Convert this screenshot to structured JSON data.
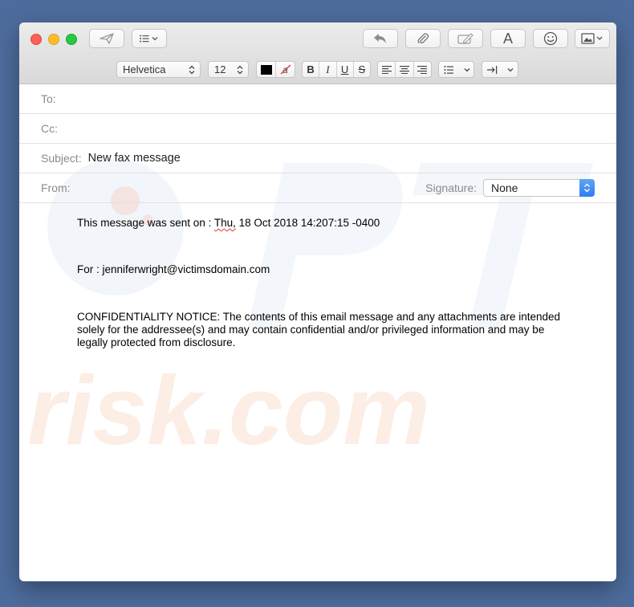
{
  "compose": {
    "toolbar": {
      "font_name": "Helvetica",
      "font_size": "12",
      "bold": "B",
      "italic": "I",
      "underline": "U",
      "strike": "S",
      "font_icon_label": "A"
    },
    "to_label": "To:",
    "to_value": "",
    "cc_label": "Cc:",
    "cc_value": "",
    "subject_label": "Subject:",
    "subject_value": "New fax message",
    "from_label": "From:",
    "signature_label": "Signature:",
    "signature_value": "None"
  },
  "message": {
    "sent_prefix": "This message was sent on : ",
    "sent_day": "Thu,",
    "sent_rest": " 18 Oct 2018 14:207:15 -0400",
    "for_line": "For : jenniferwright@victimsdomain.com",
    "notice": "CONFIDENTIALITY NOTICE: The contents of this email message and any attachments are intended solely for the addressee(s) and may contain confidential and/or privileged information and may be legally protected from disclosure."
  },
  "watermark": {
    "text": "risk.com"
  },
  "colors": {
    "desktop": "#4d6c9d",
    "accent": "#2f7df0"
  }
}
